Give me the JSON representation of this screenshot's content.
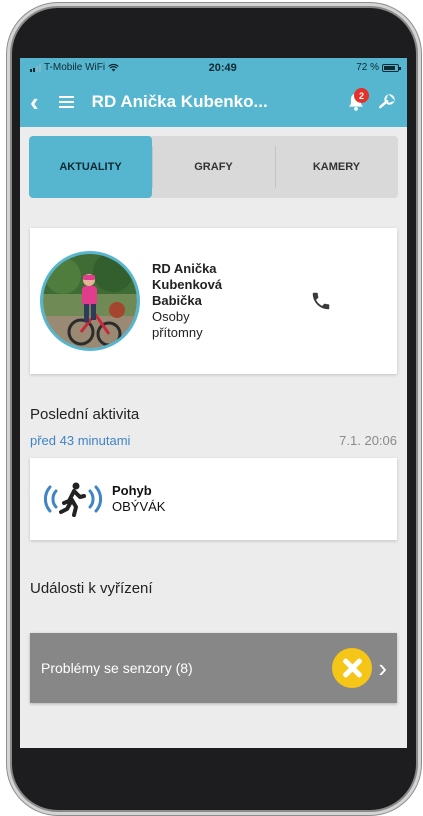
{
  "status_bar": {
    "carrier": "T-Mobile WiFi",
    "time": "20:49",
    "battery": "72 %"
  },
  "header": {
    "title": "RD Anička Kubenko...",
    "notification_count": "2"
  },
  "tabs": [
    {
      "label": "AKTUALITY",
      "active": true
    },
    {
      "label": "GRAFY",
      "active": false
    },
    {
      "label": "KAMERY",
      "active": false
    }
  ],
  "person": {
    "name_line1": "RD Anička",
    "name_line2": "Kubenková",
    "name_line3": "Babička",
    "status_line1": "Osoby",
    "status_line2": "přítomny"
  },
  "last_activity": {
    "label": "Poslední aktivita",
    "relative_time": "před 43 minutami",
    "timestamp": "7.1. 20:06",
    "title": "Pohyb",
    "location": "OBÝVÁK"
  },
  "events": {
    "label": "Události k vyřízení",
    "sensor_problem_label": "Problémy se senzory (8)"
  },
  "colors": {
    "accent": "#56b6cf",
    "warning": "#f5c518",
    "link": "#3f84c5"
  }
}
